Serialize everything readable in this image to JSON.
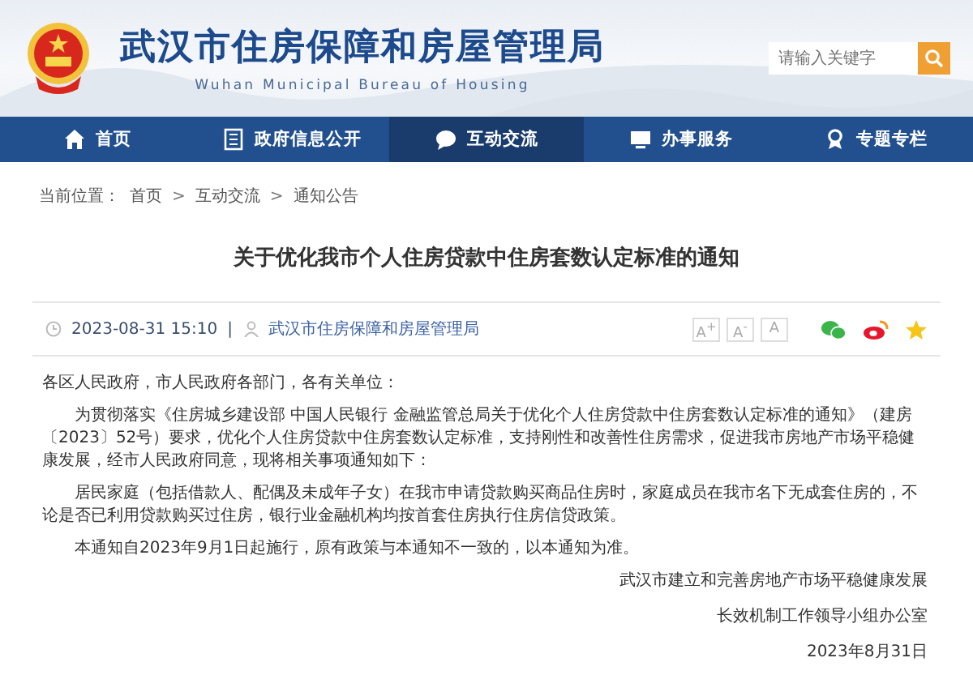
{
  "header": {
    "title": "武汉市住房保障和房屋管理局",
    "subtitle": "Wuhan Municipal Bureau of Housing",
    "search": {
      "placeholder": "请输入关键字"
    }
  },
  "nav": [
    {
      "label": "首页",
      "kind": "home",
      "selected": false
    },
    {
      "label": "政府信息公开",
      "kind": "info",
      "selected": false
    },
    {
      "label": "互动交流",
      "kind": "chat",
      "selected": true
    },
    {
      "label": "办事服务",
      "kind": "service",
      "selected": false
    },
    {
      "label": "专题专栏",
      "kind": "topic",
      "selected": false
    }
  ],
  "breadcrumb": {
    "label": "当前位置：",
    "items": [
      "首页",
      "互动交流",
      "通知公告"
    ],
    "separator": ">"
  },
  "article": {
    "title": "关于优化我市个人住房贷款中住房套数认定标准的通知",
    "date": "2023-08-31 15:10",
    "divider": "|",
    "source": "武汉市住房保障和房屋管理局",
    "font_sizes": [
      "A$^{+}$",
      "A$^{-}$",
      "A"
    ],
    "body": [
      {
        "kind": "salutation",
        "text": "各区人民政府，市人民政府各部门，各有关单位："
      },
      {
        "kind": "paragraph",
        "text": "为贯彻落实《住房城乡建设部 中国人民银行 金融监管总局关于优化个人住房贷款中住房套数认定标准的通知》（建房〔2023〕52号）要求，优化个人住房贷款中住房套数认定标准，支持刚性和改善性住房需求，促进我市房地产市场平稳健康发展，经市人民政府同意，现将相关事项通知如下："
      },
      {
        "kind": "paragraph",
        "text": "居民家庭（包括借款人、配偶及未成年子女）在我市申请贷款购买商品住房时，家庭成员在我市名下无成套住房的，不论是否已利用贷款购买过住房，银行业金融机构均按首套住房执行住房信贷政策。"
      },
      {
        "kind": "paragraph",
        "text": "本通知自2023年9月1日起施行，原有政策与本通知不一致的，以本通知为准。"
      },
      {
        "kind": "signature",
        "text": "武汉市建立和完善房地产市场平稳健康发展"
      },
      {
        "kind": "signature",
        "text": "长效机制工作领导小组办公室"
      },
      {
        "kind": "signature",
        "text": "2023年8月31日"
      }
    ]
  }
}
